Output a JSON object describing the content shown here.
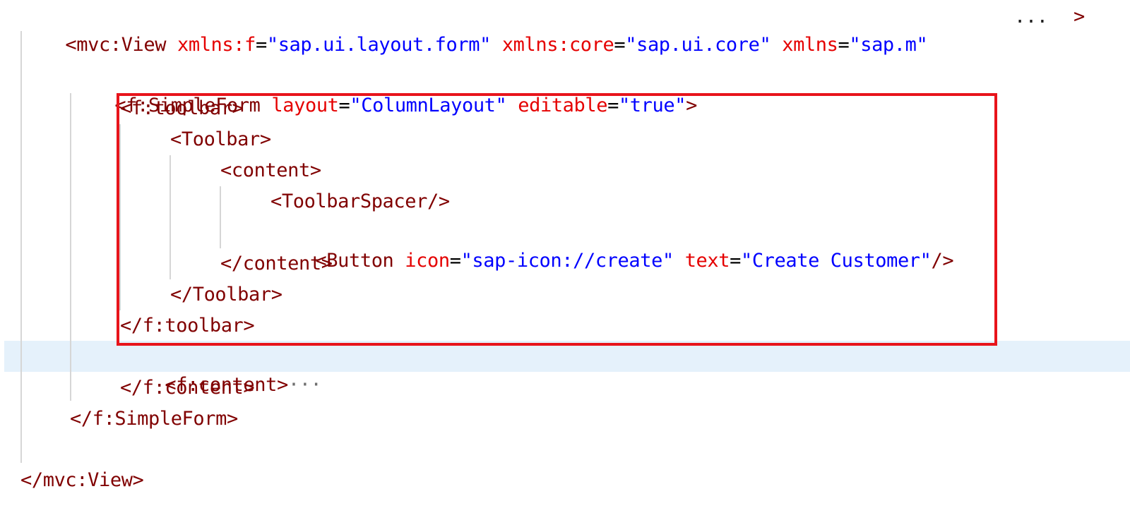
{
  "colors": {
    "tag": "#800000",
    "attribute": "#e50000",
    "value": "#0000ff",
    "punctuation": "#000000",
    "highlight_box": "#e8141b",
    "current_line_bg": "#e5f1fb"
  },
  "lines": {
    "l1": {
      "open": "<mvc:View",
      "attr1": "xmlns:f",
      "eq1": "=",
      "val1": "\"sap.ui.layout.form\"",
      "attr2": "xmlns:core",
      "eq2": "=",
      "val2": "\"sap.ui.core\"",
      "attr3": "xmlns",
      "eq3": "=",
      "val3": "\"sap.m\"",
      "ellipsis": "...",
      "close": ">"
    },
    "l3": {
      "open": "<f:SimpleForm",
      "attr1": "layout",
      "eq1": "=",
      "val1": "\"ColumnLayout\"",
      "attr2": "editable",
      "eq2": "=",
      "val2": "\"true\"",
      "close": ">"
    },
    "l4": {
      "text": "<f:toolbar>"
    },
    "l5": {
      "text": "<Toolbar>"
    },
    "l6": {
      "text": "<content>"
    },
    "l7": {
      "text": "<ToolbarSpacer/>"
    },
    "l8": {
      "open": "<Button",
      "attr1": "icon",
      "eq1": "=",
      "val1": "\"sap-icon://create\"",
      "attr2": "text",
      "eq2": "=",
      "val2": "\"Create Customer\"",
      "close": "/>"
    },
    "l9": {
      "text": "</content>"
    },
    "l10": {
      "text": "</Toolbar>"
    },
    "l11": {
      "text": "</f:toolbar>"
    },
    "l12": {
      "text": "<f:content>",
      "fold": "···"
    },
    "l13": {
      "text": "</f:content>"
    },
    "l14": {
      "text": "</f:SimpleForm>"
    },
    "l16": {
      "text": "</mvc:View>"
    }
  }
}
